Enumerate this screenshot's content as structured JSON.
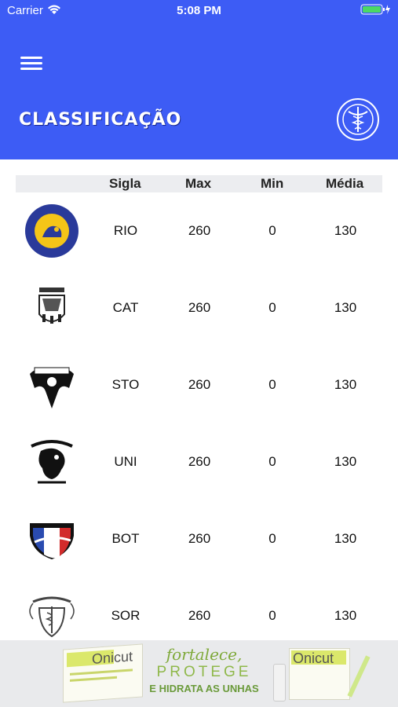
{
  "status": {
    "carrier": "Carrier",
    "time": "5:08 PM"
  },
  "header": {
    "title": "CLASSIFICAÇÃO",
    "logo_icon": "caduceus-logo-icon",
    "background": "#3d5cf5"
  },
  "table": {
    "columns": [
      "Sigla",
      "Max",
      "Min",
      "Média"
    ],
    "rows": [
      {
        "sigla": "RIO",
        "max": "260",
        "min": "0",
        "media": "130",
        "logo": "rio-preto-logo"
      },
      {
        "sigla": "CAT",
        "max": "260",
        "min": "0",
        "media": "130",
        "logo": "catanduva-logo"
      },
      {
        "sigla": "STO",
        "max": "260",
        "min": "0",
        "media": "130",
        "logo": "santo-amaro-logo"
      },
      {
        "sigla": "UNI",
        "max": "260",
        "min": "0",
        "media": "130",
        "logo": "unicamp-logo"
      },
      {
        "sigla": "BOT",
        "max": "260",
        "min": "0",
        "media": "130",
        "logo": "botucatu-logo"
      },
      {
        "sigla": "SOR",
        "max": "260",
        "min": "0",
        "media": "130",
        "logo": "sorocaba-logo"
      }
    ]
  },
  "ad": {
    "brand": "Onicut",
    "line1": "fortalece,",
    "line2": "PROTEGE",
    "line3": "E HIDRATA AS UNHAS"
  }
}
